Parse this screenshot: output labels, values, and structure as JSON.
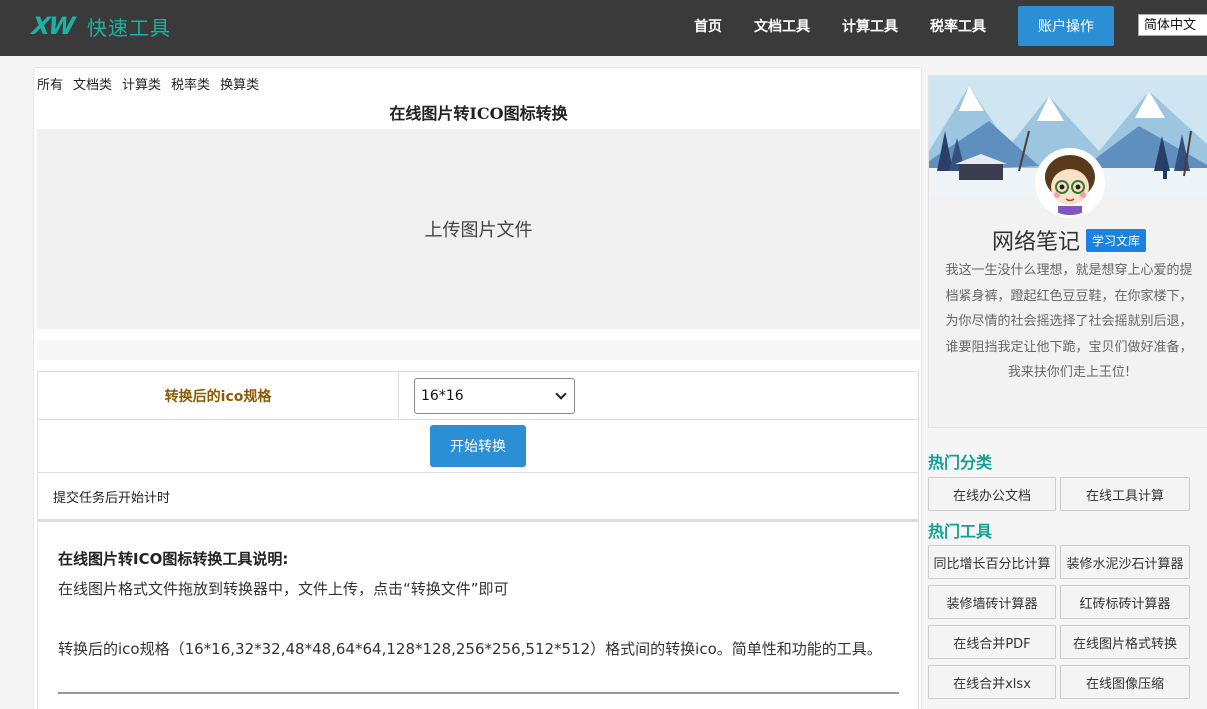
{
  "header": {
    "logo_mark": "XW",
    "logo_text": "快速工具",
    "nav": [
      "首页",
      "文档工具",
      "计算工具",
      "税率工具"
    ],
    "account_button": "账户操作",
    "language": "简体中文"
  },
  "categories": [
    "所有",
    "文档类",
    "计算类",
    "税率类",
    "换算类"
  ],
  "tool": {
    "title": "在线图片转ICO图标转换",
    "upload_label": "上传图片文件",
    "option_label": "转换后的ico规格",
    "option_value": "16*16",
    "start_button": "开始转换",
    "timer_text": "提交任务后开始计时"
  },
  "description": {
    "title": "在线图片转ICO图标转换工具说明:",
    "line1": "在线图片格式文件拖放到转换器中，文件上传，点击“转换文件”即可",
    "line2": "转换后的ico规格（16*16,32*32,48*48,64*64,128*128,256*256,512*512）格式间的转换ico。简单性和功能的工具。"
  },
  "profile": {
    "name": "网络笔记",
    "badge": "学习文库",
    "bio": "我这一生没什么理想，就是想穿上心爱的提档紧身裤，蹬起红色豆豆鞋，在你家楼下，为你尽情的社会摇选择了社会摇就别后退，谁要阻挡我定让他下跪，宝贝们做好准备，我来扶你们走上王位!"
  },
  "hot_categories": {
    "title": "热门分类",
    "items": [
      "在线办公文档",
      "在线工具计算"
    ]
  },
  "hot_tools": {
    "title": "热门工具",
    "items": [
      "同比增长百分比计算",
      "装修水泥沙石计算器",
      "装修墙砖计算器",
      "红砖标砖计算器",
      "在线合并PDF",
      "在线图片格式转换",
      "在线合并xlsx",
      "在线图像压缩"
    ]
  },
  "colors": {
    "header_bg": "#3a3a3a",
    "brand": "#1ab3a3",
    "primary_button": "#2b8fd6",
    "option_label": "#8a5a00"
  }
}
